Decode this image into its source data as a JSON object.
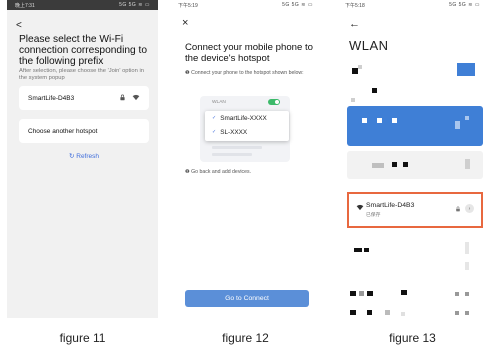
{
  "phone1": {
    "status_time": "晚上7:31",
    "status_icons": "5G 5G ≋ ▭",
    "back": "<",
    "title": "Please select the Wi-Fi connection corresponding to the following prefix",
    "subtitle": "After selection, please choose the 'Join' option in the system popup",
    "hotspot_name": "SmartLife-D4B3",
    "lock_icon": "lock-icon",
    "wifi_icon": "wifi-icon",
    "another_label": "Choose another hotspot",
    "refresh_label": "Refresh",
    "caption": "figure 11"
  },
  "phone2": {
    "status_time": "下午5:19",
    "status_icons": "5G 5G ≋ ▭",
    "close": "×",
    "title": "Connect your mobile phone to the device's hotspot",
    "hint": "❶ Connect your phone to the hotspot shown below:",
    "wlan_label": "WLAN",
    "network_1": "SmartLife-XXXX",
    "network_2": "SL-XXXX",
    "back_hint": "❷ Go back and add devices.",
    "go_label": "Go to Connect",
    "caption": "figure 12"
  },
  "phone3": {
    "status_time": "下午5:18",
    "status_icons": "5G 5G ≋ ▭",
    "back": "←",
    "title": "WLAN",
    "network_name": "SmartLife-D4B3",
    "network_status": "已保存",
    "caption": "figure 13"
  },
  "colors": {
    "accent_blue": "#3f7fd6",
    "button_blue": "#5b8fd8",
    "highlight_orange": "#e8683f",
    "toggle_green": "#3dba6a"
  }
}
